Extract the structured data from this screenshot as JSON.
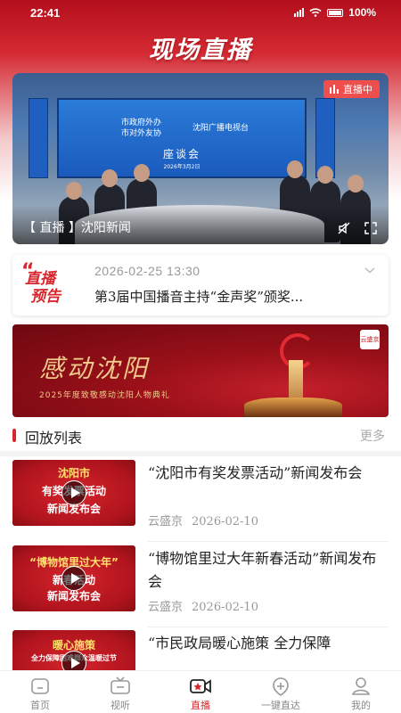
{
  "status": {
    "time": "22:41",
    "battery": "100%"
  },
  "page_title": "现场直播",
  "live": {
    "tag": "直播中",
    "caption": "【 直播 】沈阳新闻",
    "screen": {
      "line1": "市政府外办",
      "line2": "市对外友协",
      "org": "沈阳广播电视台",
      "title": "座谈会",
      "date": "2026年3月2日"
    }
  },
  "preview": {
    "logo_line1": "直播",
    "logo_line2": "预告",
    "datetime": "2026-02-25  13:30",
    "title": "第3届中国播音主持“金声奖”颁奖..."
  },
  "promo": {
    "title": "感动沈阳",
    "subtitle": "2025年度致敬感动沈阳人物典礼",
    "badge": "云盛京"
  },
  "replay": {
    "title": "回放列表",
    "more": "更多",
    "items": [
      {
        "thumb_lines": [
          "沈阳市",
          "有奖发票活动",
          "新闻发布会"
        ],
        "title": "“沈阳市有奖发票活动”新闻发布会",
        "source": "云盛京",
        "date": "2026-02-10"
      },
      {
        "thumb_lines": [
          "“博物馆里过大年”",
          "新春活动",
          "新闻发布会"
        ],
        "title": "“博物馆里过大年新春活动”新闻发布会",
        "source": "云盛京",
        "date": "2026-02-10"
      },
      {
        "thumb_lines": [
          "暖心施策",
          "全力保障困难群众温暖过节",
          ""
        ],
        "title": "“市民政局暖心施策 全力保障",
        "source": "",
        "date": ""
      }
    ]
  },
  "nav": {
    "items": [
      {
        "label": "首页",
        "icon": "home-icon"
      },
      {
        "label": "视听",
        "icon": "tv-icon"
      },
      {
        "label": "直播",
        "icon": "live-camera-icon",
        "active": true
      },
      {
        "label": "一键直达",
        "icon": "direct-icon"
      },
      {
        "label": "我的",
        "icon": "profile-icon"
      }
    ]
  },
  "colors": {
    "accent": "#d7262d",
    "live_tag": "#f04d4d"
  }
}
